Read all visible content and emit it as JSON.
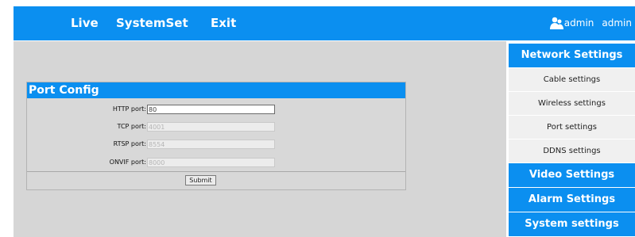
{
  "topnav": {
    "items": [
      "Live",
      "SystemSet",
      "Exit"
    ],
    "user_role": "admin",
    "user_name": "admin"
  },
  "port_config": {
    "title": "Port Config",
    "fields": [
      {
        "label": "HTTP port:",
        "value": "80"
      },
      {
        "label": "TCP port:",
        "value": "4001"
      },
      {
        "label": "RTSP port:",
        "value": "8554"
      },
      {
        "label": "ONVIF port:",
        "value": "8000"
      }
    ],
    "submit_label": "Submit"
  },
  "sidebar": {
    "network_settings": "Network Settings",
    "sub_items": [
      "Cable settings",
      "Wireless settings",
      "Port settings",
      "DDNS settings"
    ],
    "video_settings": "Video Settings",
    "alarm_settings": "Alarm Settings",
    "system_settings": "System settings"
  },
  "colors": {
    "accent": "#0b8ff0",
    "content_bg": "#d6d6d6",
    "submenu_bg": "#f0f0f0"
  }
}
